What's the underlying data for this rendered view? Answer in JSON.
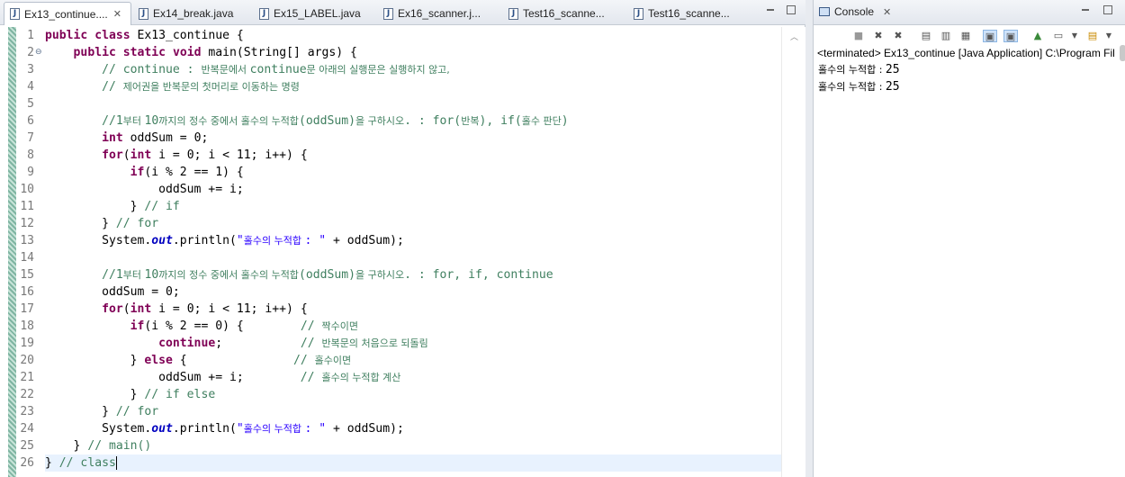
{
  "editor": {
    "tabs": [
      {
        "label": "Ex13_continue....",
        "active": true,
        "icon": "java-file-icon"
      },
      {
        "label": "Ex14_break.java",
        "active": false,
        "icon": "java-file-icon"
      },
      {
        "label": "Ex15_LABEL.java",
        "active": false,
        "icon": "java-file-icon"
      },
      {
        "label": "Ex16_scanner.j...",
        "active": false,
        "icon": "java-file-icon"
      },
      {
        "label": "Test16_scanne...",
        "active": false,
        "icon": "java-file-icon"
      },
      {
        "label": "Test16_scanne...",
        "active": false,
        "icon": "java-file-icon"
      }
    ],
    "close_glyph": "✕",
    "line_numbers": [
      "1",
      "2",
      "3",
      "4",
      "5",
      "6",
      "7",
      "8",
      "9",
      "10",
      "11",
      "12",
      "13",
      "14",
      "15",
      "16",
      "17",
      "18",
      "19",
      "20",
      "21",
      "22",
      "23",
      "24",
      "25",
      "26"
    ],
    "fold_marker": "⊖",
    "current_line": 26
  },
  "console": {
    "title": "Console",
    "close_glyph": "✕",
    "status_line": "<terminated> Ex13_continue [Java Application] C:\\Program Fil",
    "output": [
      {
        "label": "홀수의 누적합 : ",
        "value": "25"
      },
      {
        "label": "홀수의 누적합 : ",
        "value": "25"
      }
    ]
  },
  "colors": {
    "keyword": "#7f0055",
    "comment": "#3f7f5f",
    "string": "#2a00ff",
    "static_field": "#0000c0",
    "current_line": "#e8f2fe"
  }
}
